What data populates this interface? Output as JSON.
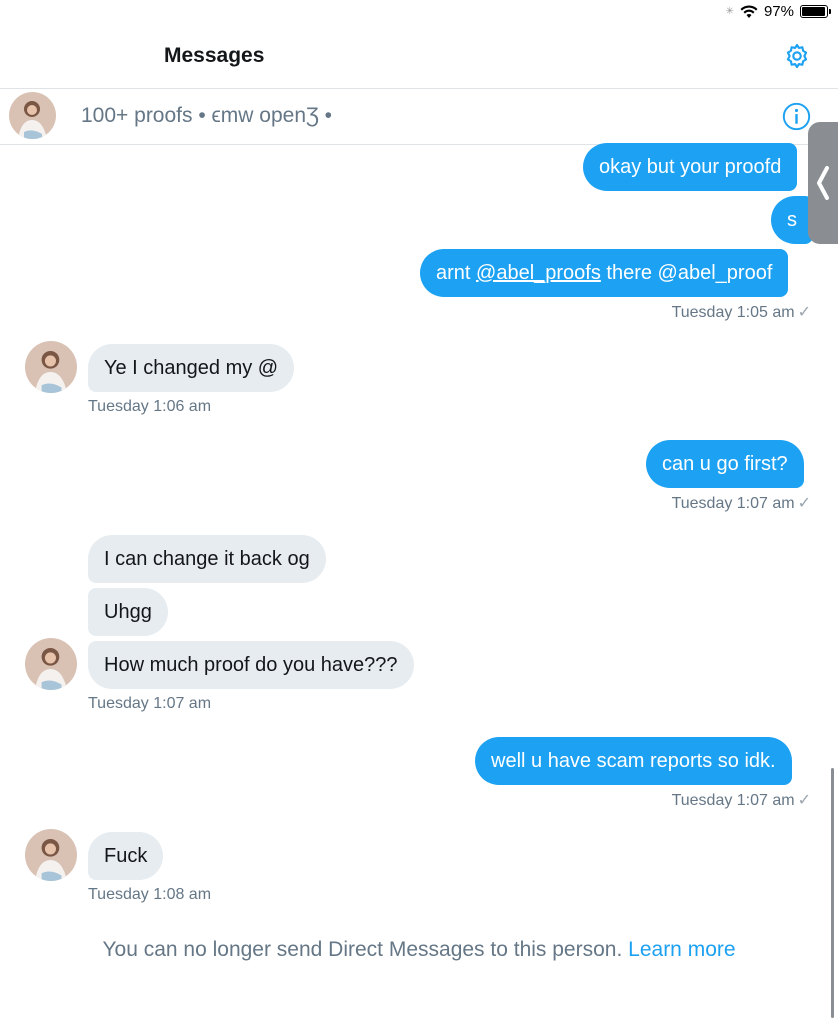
{
  "status_bar": {
    "battery_text": "97%",
    "battery_level": 0.97
  },
  "header": {
    "title": "Messages",
    "settings_icon": "gear-icon"
  },
  "conversation": {
    "name": "100+ proofs • ϵmw openƷ •",
    "info_icon": "info-icon"
  },
  "messages": [
    {
      "direction": "out",
      "text": "okay but your proofd"
    },
    {
      "direction": "out",
      "text": "s"
    },
    {
      "direction": "out",
      "text_before": "arnt ",
      "mention": "@abel_proofs",
      "text_after": " there @abel_proof"
    },
    {
      "direction": "out",
      "timestamp": "Tuesday 1:05 am"
    },
    {
      "direction": "in",
      "text": "Ye I changed my @"
    },
    {
      "direction": "in",
      "timestamp": "Tuesday 1:06 am"
    },
    {
      "direction": "out",
      "text": "can u go first?"
    },
    {
      "direction": "out",
      "timestamp": "Tuesday 1:07 am"
    },
    {
      "direction": "in",
      "text": "I can change it back og"
    },
    {
      "direction": "in",
      "text": "Uhgg"
    },
    {
      "direction": "in",
      "text": "How much proof do you have???"
    },
    {
      "direction": "in",
      "timestamp": "Tuesday 1:07 am"
    },
    {
      "direction": "out",
      "text": "well u have scam reports so idk."
    },
    {
      "direction": "out",
      "timestamp": "Tuesday 1:07 am"
    },
    {
      "direction": "in",
      "text": "Fuck"
    },
    {
      "direction": "in",
      "timestamp": "Tuesday 1:08 am"
    }
  ],
  "notice": {
    "text": "You can no longer send Direct Messages to this person.",
    "link": "Learn more"
  },
  "colors": {
    "accent": "#1da1f2",
    "incoming_bubble": "#e6ecf0",
    "secondary_text": "#657786"
  }
}
